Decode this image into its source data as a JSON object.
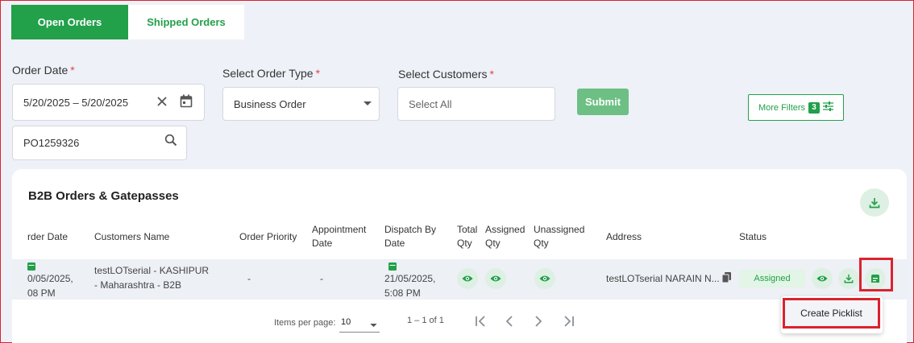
{
  "tabs": {
    "open": "Open Orders",
    "shipped": "Shipped Orders"
  },
  "filters": {
    "order_date_label": "Order Date",
    "order_date_value": "5/20/2025 – 5/20/2025",
    "order_type_label": "Select Order Type",
    "order_type_value": "Business Order",
    "customers_label": "Select Customers",
    "customers_placeholder": "Select All",
    "search_value": "PO1259326",
    "required_mark": "*",
    "submit_label": "Submit",
    "more_filters_label": "More Filters",
    "more_filters_count": "3"
  },
  "card": {
    "title": "B2B Orders & Gatepasses",
    "headers": {
      "order_date": "rder Date",
      "customers_name": "Customers Name",
      "order_priority": "Order Priority",
      "appointment_l1": "Appointment",
      "appointment_l2": "Date",
      "dispatch_l1": "Dispatch By",
      "dispatch_l2": "Date",
      "total_l1": "Total",
      "total_l2": "Qty",
      "assigned_l1": "Assigned",
      "assigned_l2": "Qty",
      "unassigned_l1": "Unassigned",
      "unassigned_l2": "Qty",
      "address": "Address",
      "status": "Status"
    },
    "row": {
      "order_date_l1": "0/05/2025,",
      "order_date_l2": "08 PM",
      "customer_l1": "testLOTserial - KASHIPUR",
      "customer_l2": "- Maharashtra - B2B",
      "priority": "-",
      "appointment": "-",
      "dispatch_l1": "21/05/2025,",
      "dispatch_l2": "5:08 PM",
      "address": "testLOTserial NARAIN N...",
      "status": "Assigned"
    }
  },
  "pager": {
    "items_per_page_label": "Items per page:",
    "items_per_page_value": "10",
    "range": "1 – 1 of 1"
  },
  "context_menu": {
    "create_picklist": "Create Picklist"
  },
  "colors": {
    "brand_green": "#22a04a",
    "highlight_red": "#d9232e"
  }
}
